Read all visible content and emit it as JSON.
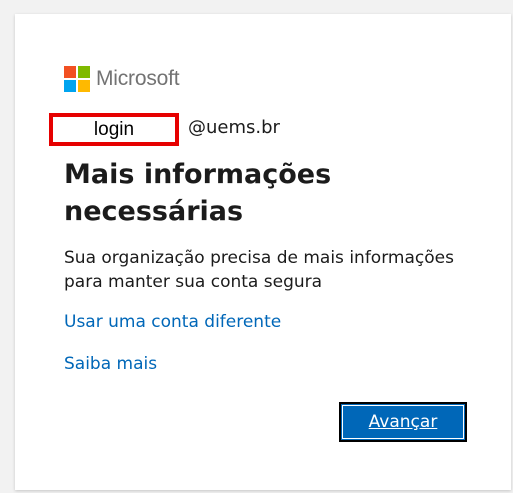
{
  "brand": {
    "name": "Microsoft",
    "icon": "microsoft-logo-icon",
    "colors": [
      "#f25022",
      "#7fba00",
      "#00a4ef",
      "#ffb900"
    ]
  },
  "account": {
    "login_placeholder": "login",
    "domain": "@uems.br"
  },
  "title": "Mais informações necessárias",
  "description": "Sua organização precisa de mais informações para manter sua conta segura",
  "links": {
    "use_other_account": "Usar uma conta diferente",
    "learn_more": "Saiba mais"
  },
  "buttons": {
    "next": "Avançar"
  },
  "colors": {
    "accent": "#0067b8",
    "highlight_border": "#e60000",
    "text": "#1b1b1b",
    "background": "#f2f2f2"
  }
}
